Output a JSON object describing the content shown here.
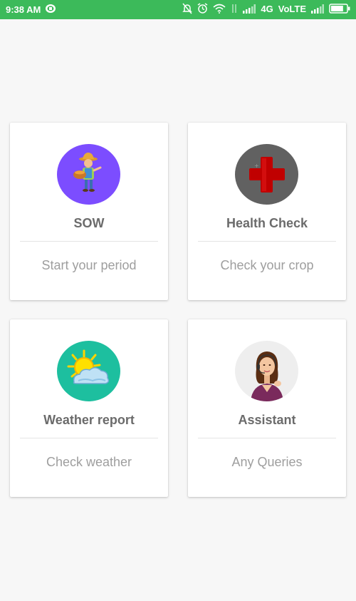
{
  "status_bar": {
    "time": "9:38 AM",
    "network": "4G",
    "volte": "VoLTE",
    "icons": [
      "notification-app-icon",
      "mute-bell-icon",
      "alarm-icon",
      "wifi-icon",
      "data-arrows-icon",
      "signal-icon",
      "signal-icon-2",
      "battery-icon"
    ],
    "battery_level_fraction": 0.8
  },
  "cards": [
    {
      "title": "SOW",
      "subtitle": "Start your period",
      "icon": "farmer-icon",
      "icon_bg": "#7c4dff"
    },
    {
      "title": "Health Check",
      "subtitle": "Check your crop",
      "icon": "medical-cross-icon",
      "icon_bg": "#616161"
    },
    {
      "title": "Weather report",
      "subtitle": "Check weather",
      "icon": "sun-cloud-icon",
      "icon_bg": "#1dbf9f"
    },
    {
      "title": "Assistant",
      "subtitle": "Any Queries",
      "icon": "support-agent-icon",
      "icon_bg": "#eeeeee"
    }
  ],
  "colors": {
    "status_bar": "#3cba5a",
    "background": "#f7f7f7",
    "title_text": "#6b6b6b",
    "subtitle_text": "#9e9e9e"
  }
}
